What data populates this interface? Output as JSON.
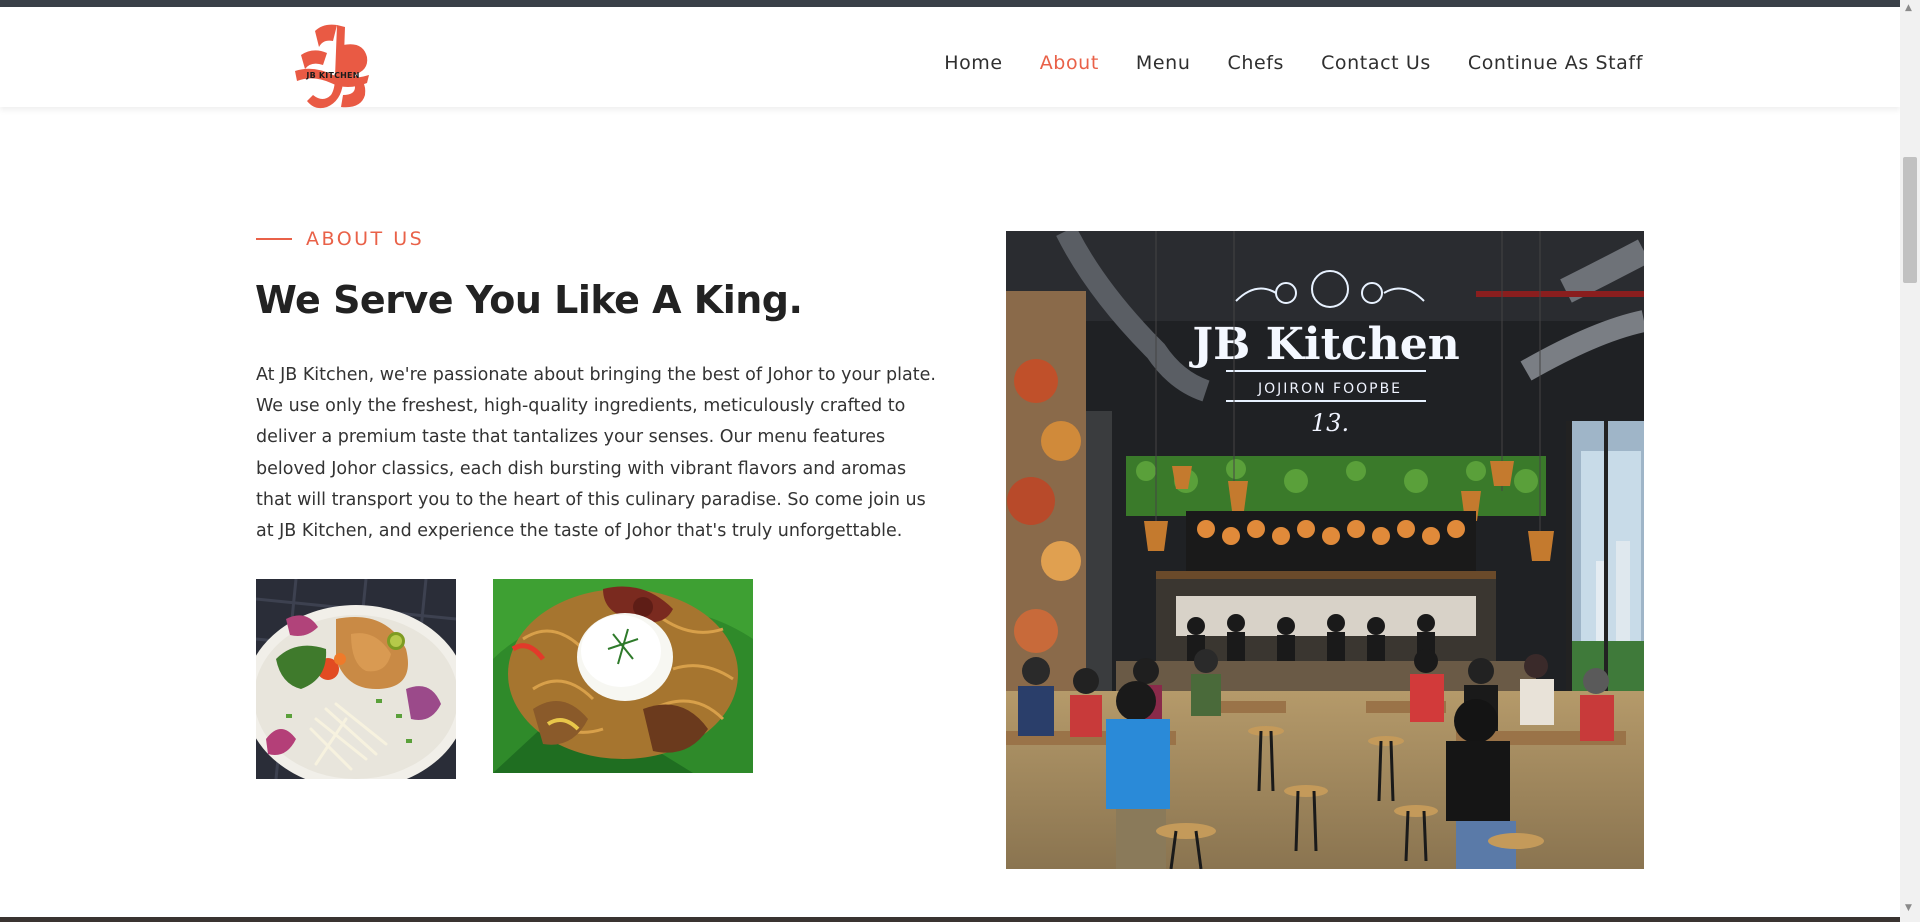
{
  "brand": {
    "logo_text": "JB KITCHEN",
    "accent_color": "#e96148"
  },
  "nav": {
    "items": [
      {
        "label": "Home"
      },
      {
        "label": "About",
        "active": true
      },
      {
        "label": "Menu"
      },
      {
        "label": "Chefs"
      },
      {
        "label": "Contact Us"
      },
      {
        "label": "Continue As Staff"
      }
    ]
  },
  "about": {
    "section_label": "ABOUT US",
    "heading": "We Serve You Like A King.",
    "paragraph": "At JB Kitchen, we're passionate about bringing the best of Johor to your plate. We use only the freshest, high-quality ingredients, meticulously crafted to deliver a premium taste that tantalizes your senses. Our menu features beloved Johor classics, each dish bursting with vibrant flavors and aromas that will transport you to the heart of this culinary paradise. So come join us at JB Kitchen, and experience the taste of Johor that's truly unforgettable."
  },
  "restaurant_sign": {
    "name": "JB Kitchen",
    "subtitle": "JOJIRON FOOPBE",
    "line": "13."
  }
}
